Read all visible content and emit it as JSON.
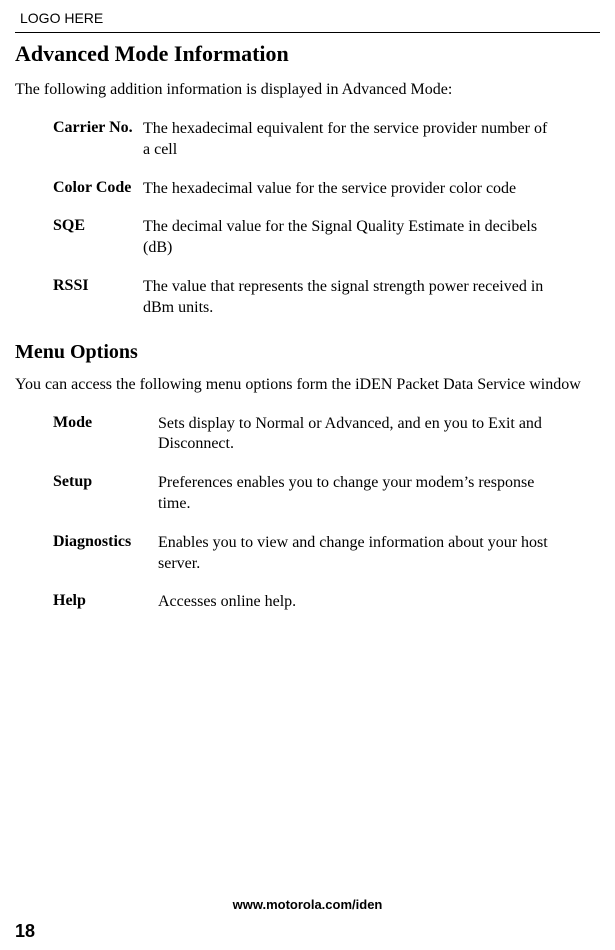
{
  "logo_text": "LOGO HERE",
  "section1": {
    "title": "Advanced Mode Information",
    "intro": "The following addition information is displayed in Advanced Mode:",
    "defs": [
      {
        "term": "Carrier No.",
        "desc": "The hexadecimal equivalent for the service provider number of a cell"
      },
      {
        "term": "Color Code",
        "desc": "The hexadecimal value for the service provider color code"
      },
      {
        "term": "SQE",
        "desc": "The decimal value for the Signal Quality Estimate in decibels (dB)"
      },
      {
        "term": "RSSI",
        "desc": "The value that represents the signal strength power received in dBm units."
      }
    ]
  },
  "section2": {
    "title": "Menu Options",
    "intro": "You can access the following menu options form the iDEN Packet Data Service window",
    "defs": [
      {
        "term": "Mode",
        "desc": "Sets display to Normal or Advanced, and en you to Exit and Disconnect."
      },
      {
        "term": "Setup",
        "desc": "Preferences enables you to change your modem’s response time."
      },
      {
        "term": "Diagnostics",
        "desc": "Enables you to view and change information about your host server."
      },
      {
        "term": "Help",
        "desc": "Accesses online help."
      }
    ]
  },
  "footer_url": "www.motorola.com/iden",
  "page_number": "18"
}
